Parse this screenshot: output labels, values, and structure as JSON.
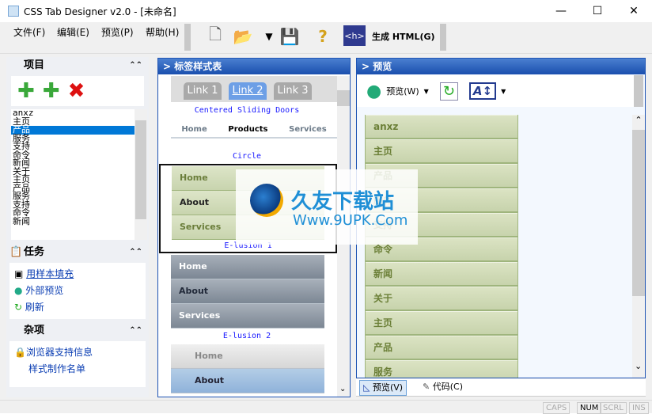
{
  "window": {
    "title": "CSS Tab Designer v2.0 - [未命名]",
    "minimize": "—",
    "maximize": "☐",
    "close": "✕"
  },
  "menu": {
    "items": [
      "文件(F)",
      "编辑(E)",
      "预览(P)",
      "帮助(H)"
    ]
  },
  "toolbar": {
    "generate_label": "生成 HTML(G)"
  },
  "left": {
    "items_title": "项目",
    "items": [
      "anxz",
      "主页",
      "产品",
      "服务",
      "支持",
      "命令",
      "新闻",
      "关于",
      "主页",
      "产品",
      "服务",
      "支持",
      "命令",
      "新闻"
    ],
    "selected_index": 2,
    "tasks_title": "任务",
    "tasks": [
      "用样本填充",
      "外部预览",
      "刷新"
    ],
    "misc_title": "杂项",
    "misc": [
      "浏览器支持信息",
      "样式制作名单"
    ]
  },
  "styles": {
    "title": "> 标签样式表",
    "tabs": [
      "Link 1",
      "Link 2",
      "Link 3"
    ],
    "caption1": "Centered Sliding Doors",
    "nav2": [
      "Home",
      "Products",
      "Services"
    ],
    "caption2": "Circle",
    "elusion1": [
      "Home",
      "About",
      "Services"
    ],
    "caption3": "E-lusion 1",
    "elusion2": [
      "Home",
      "About",
      "Services"
    ],
    "caption4": "E-lusion 2",
    "last": [
      "Home",
      "About"
    ]
  },
  "preview": {
    "title": "> 预览",
    "preview_btn": "预览(W)",
    "items": [
      "anxz",
      "主页",
      "产品",
      "服务",
      "支持",
      "命令",
      "新闻",
      "关于",
      "主页",
      "产品",
      "服务"
    ],
    "tab_preview": "预览(V)",
    "tab_code": "代码(C)"
  },
  "status": {
    "indicators": [
      "CAPS",
      "NUM",
      "SCRL",
      "INS"
    ],
    "active": "NUM"
  },
  "watermark": {
    "text": "久友下载站",
    "url": "Www.9UPK.Com",
    "faint": "WWW.9UPK.COM"
  }
}
